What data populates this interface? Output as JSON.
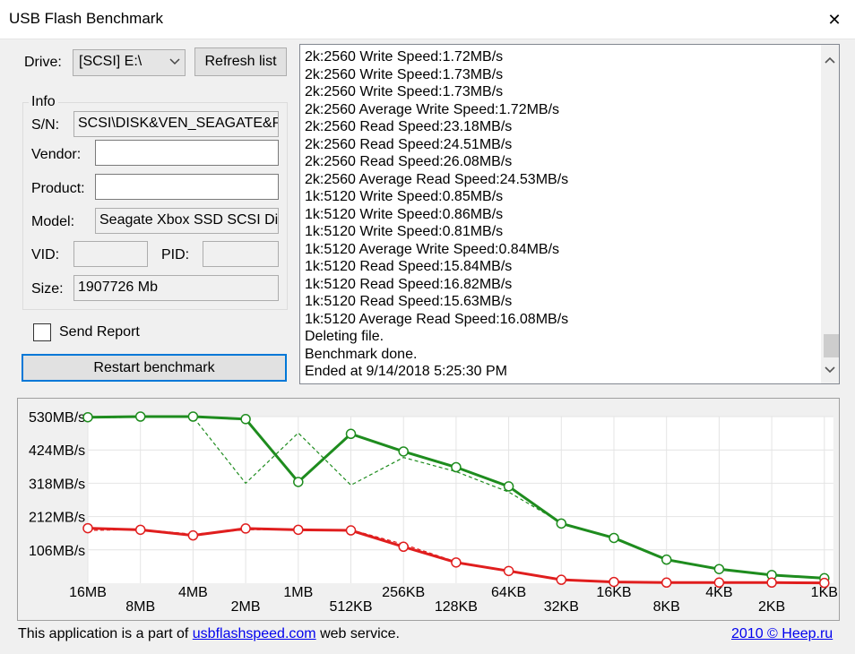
{
  "window": {
    "title": "USB Flash Benchmark",
    "close_glyph": "✕"
  },
  "drive": {
    "label": "Drive:",
    "selected": "[SCSI] E:\\",
    "refresh_label": "Refresh list"
  },
  "info": {
    "group_label": "Info",
    "sn_label": "S/N:",
    "sn_value": "SCSI\\DISK&VEN_SEAGATE&P",
    "vendor_label": "Vendor:",
    "vendor_value": "",
    "product_label": "Product:",
    "product_value": "",
    "model_label": "Model:",
    "model_value": "Seagate Xbox SSD SCSI Di",
    "vid_label": "VID:",
    "vid_value": "",
    "pid_label": "PID:",
    "pid_value": "",
    "size_label": "Size:",
    "size_value": "1907726 Mb"
  },
  "send_report": {
    "label": "Send Report",
    "checked": false
  },
  "restart_label": "Restart benchmark",
  "log_lines": [
    "2k:2560 Write Speed:1.72MB/s",
    "2k:2560 Write Speed:1.73MB/s",
    "2k:2560 Write Speed:1.73MB/s",
    "2k:2560 Average Write Speed:1.72MB/s",
    "2k:2560 Read Speed:23.18MB/s",
    "2k:2560 Read Speed:24.51MB/s",
    "2k:2560 Read Speed:26.08MB/s",
    "2k:2560 Average Read Speed:24.53MB/s",
    "1k:5120 Write Speed:0.85MB/s",
    "1k:5120 Write Speed:0.86MB/s",
    "1k:5120 Write Speed:0.81MB/s",
    "1k:5120 Average Write Speed:0.84MB/s",
    "1k:5120 Read Speed:15.84MB/s",
    "1k:5120 Read Speed:16.82MB/s",
    "1k:5120 Read Speed:15.63MB/s",
    "1k:5120 Average Read Speed:16.08MB/s",
    "Deleting file.",
    "Benchmark done.",
    "Ended at 9/14/2018 5:25:30 PM"
  ],
  "chart_data": {
    "type": "line",
    "categories": [
      "16MB",
      "8MB",
      "4MB",
      "2MB",
      "1MB",
      "512KB",
      "256KB",
      "128KB",
      "64KB",
      "32KB",
      "16KB",
      "8KB",
      "4KB",
      "2KB",
      "1KB"
    ],
    "y_ticks": [
      "530MB/s",
      "424MB/s",
      "318MB/s",
      "212MB/s",
      "106MB/s"
    ],
    "y_tick_values": [
      530,
      424,
      318,
      212,
      106
    ],
    "ylim": [
      0,
      530
    ],
    "grid": true,
    "series": [
      {
        "role": "read-average",
        "color": "#1e8c1e",
        "style": "solid",
        "markers": true,
        "values": [
          528,
          530,
          530,
          522,
          322,
          475,
          419,
          369,
          308,
          190,
          144,
          75,
          45,
          26,
          16
        ]
      },
      {
        "role": "read-detail",
        "color": "#1e8c1e",
        "style": "dashed",
        "markers": false,
        "values": [
          526,
          528,
          529,
          318,
          478,
          312,
          400,
          355,
          290,
          192,
          145,
          74,
          44,
          25,
          16
        ]
      },
      {
        "role": "write-average",
        "color": "#e01e1e",
        "style": "solid",
        "markers": true,
        "values": [
          175,
          170,
          152,
          174,
          170,
          168,
          116,
          66,
          39,
          11,
          4,
          2,
          2,
          2,
          1
        ]
      },
      {
        "role": "write-detail",
        "color": "#e01e1e",
        "style": "dashed",
        "markers": false,
        "values": [
          168,
          171,
          156,
          170,
          171,
          170,
          124,
          68,
          40,
          12,
          4,
          2,
          2,
          2,
          1
        ]
      }
    ]
  },
  "footer": {
    "prefix": "This application is a part of ",
    "link_text": "usbflashspeed.com",
    "suffix": " web service.",
    "credit": "2010 © Heep.ru"
  }
}
